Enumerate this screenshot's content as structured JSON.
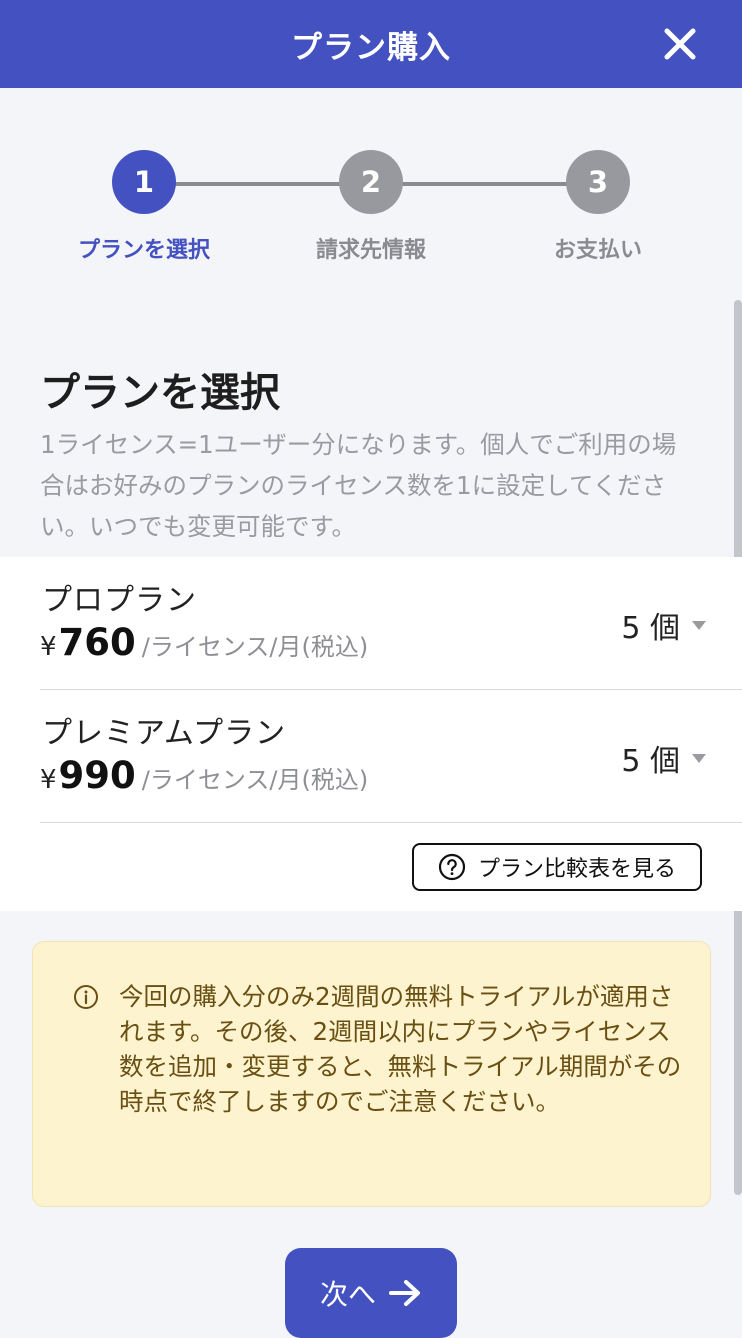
{
  "header": {
    "title": "プラン購入",
    "close_icon": "close-icon"
  },
  "stepper": {
    "steps": [
      {
        "number": "1",
        "label": "プランを選択",
        "active": true
      },
      {
        "number": "2",
        "label": "請求先情報",
        "active": false
      },
      {
        "number": "3",
        "label": "お支払い",
        "active": false
      }
    ]
  },
  "section": {
    "title": "プランを選択",
    "description": "1ライセンス=1ユーザー分になります。個人でご利用の場合はお好みのプランのライセンス数を1に設定してください。いつでも変更可能です。"
  },
  "plans": [
    {
      "name": "プロプラン",
      "currency": "¥",
      "price": "760",
      "unit": "/ライセンス/月(税込)",
      "quantity": "5 個"
    },
    {
      "name": "プレミアムプラン",
      "currency": "¥",
      "price": "990",
      "unit": "/ライセンス/月(税込)",
      "quantity": "5 個"
    }
  ],
  "compare": {
    "label": "プラン比較表を見る",
    "icon": "help-circle-icon"
  },
  "notice": {
    "icon": "info-icon",
    "text": "今回の購入分のみ2週間の無料トライアルが適用されます。その後、2週間以内にプランやライセンス数を追加・変更すると、無料トライアル期間がその時点で終了しますのでご注意ください。"
  },
  "next_button": {
    "label": "次へ",
    "icon": "arrow-right-icon"
  },
  "colors": {
    "primary": "#4352c0",
    "inactive_step": "#98999e",
    "notice_bg": "#fdf3cf",
    "notice_text": "#6a4f12",
    "background": "#f4f5f9"
  }
}
